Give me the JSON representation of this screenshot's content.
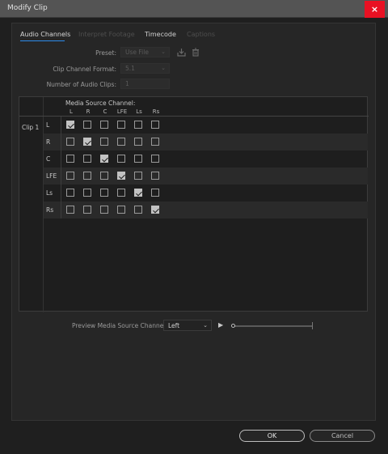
{
  "window": {
    "title": "Modify Clip",
    "close_glyph": "×"
  },
  "tabs": [
    {
      "label": "Audio Channels",
      "state": "active"
    },
    {
      "label": "Interpret Footage",
      "state": "disabled"
    },
    {
      "label": "Timecode",
      "state": "enabled"
    },
    {
      "label": "Captions",
      "state": "disabled"
    }
  ],
  "fields": {
    "preset_label": "Preset:",
    "preset_value": "Use File",
    "format_label": "Clip Channel Format:",
    "format_value": "5.1",
    "clips_label": "Number of Audio Clips:",
    "clips_value": "1"
  },
  "icons": {
    "save_preset": "save-preset-icon",
    "delete_preset": "trash-icon"
  },
  "matrix": {
    "header": "Media Source Channel:",
    "columns": [
      "L",
      "R",
      "C",
      "LFE",
      "Ls",
      "Rs"
    ],
    "clip_label": "Clip 1",
    "rows": [
      {
        "label": "L",
        "checks": [
          true,
          false,
          false,
          false,
          false,
          false
        ]
      },
      {
        "label": "R",
        "checks": [
          false,
          true,
          false,
          false,
          false,
          false
        ]
      },
      {
        "label": "C",
        "checks": [
          false,
          false,
          true,
          false,
          false,
          false
        ]
      },
      {
        "label": "LFE",
        "checks": [
          false,
          false,
          false,
          true,
          false,
          false
        ]
      },
      {
        "label": "Ls",
        "checks": [
          false,
          false,
          false,
          false,
          true,
          false
        ]
      },
      {
        "label": "Rs",
        "checks": [
          false,
          false,
          false,
          false,
          false,
          true
        ]
      }
    ]
  },
  "preview": {
    "label": "Preview Media Source Channel:",
    "value": "Left",
    "play_glyph": "▶",
    "chevron_glyph": "⌄"
  },
  "buttons": {
    "ok": "OK",
    "cancel": "Cancel"
  },
  "colors": {
    "accent": "#2d8ceb",
    "close": "#e81123"
  }
}
